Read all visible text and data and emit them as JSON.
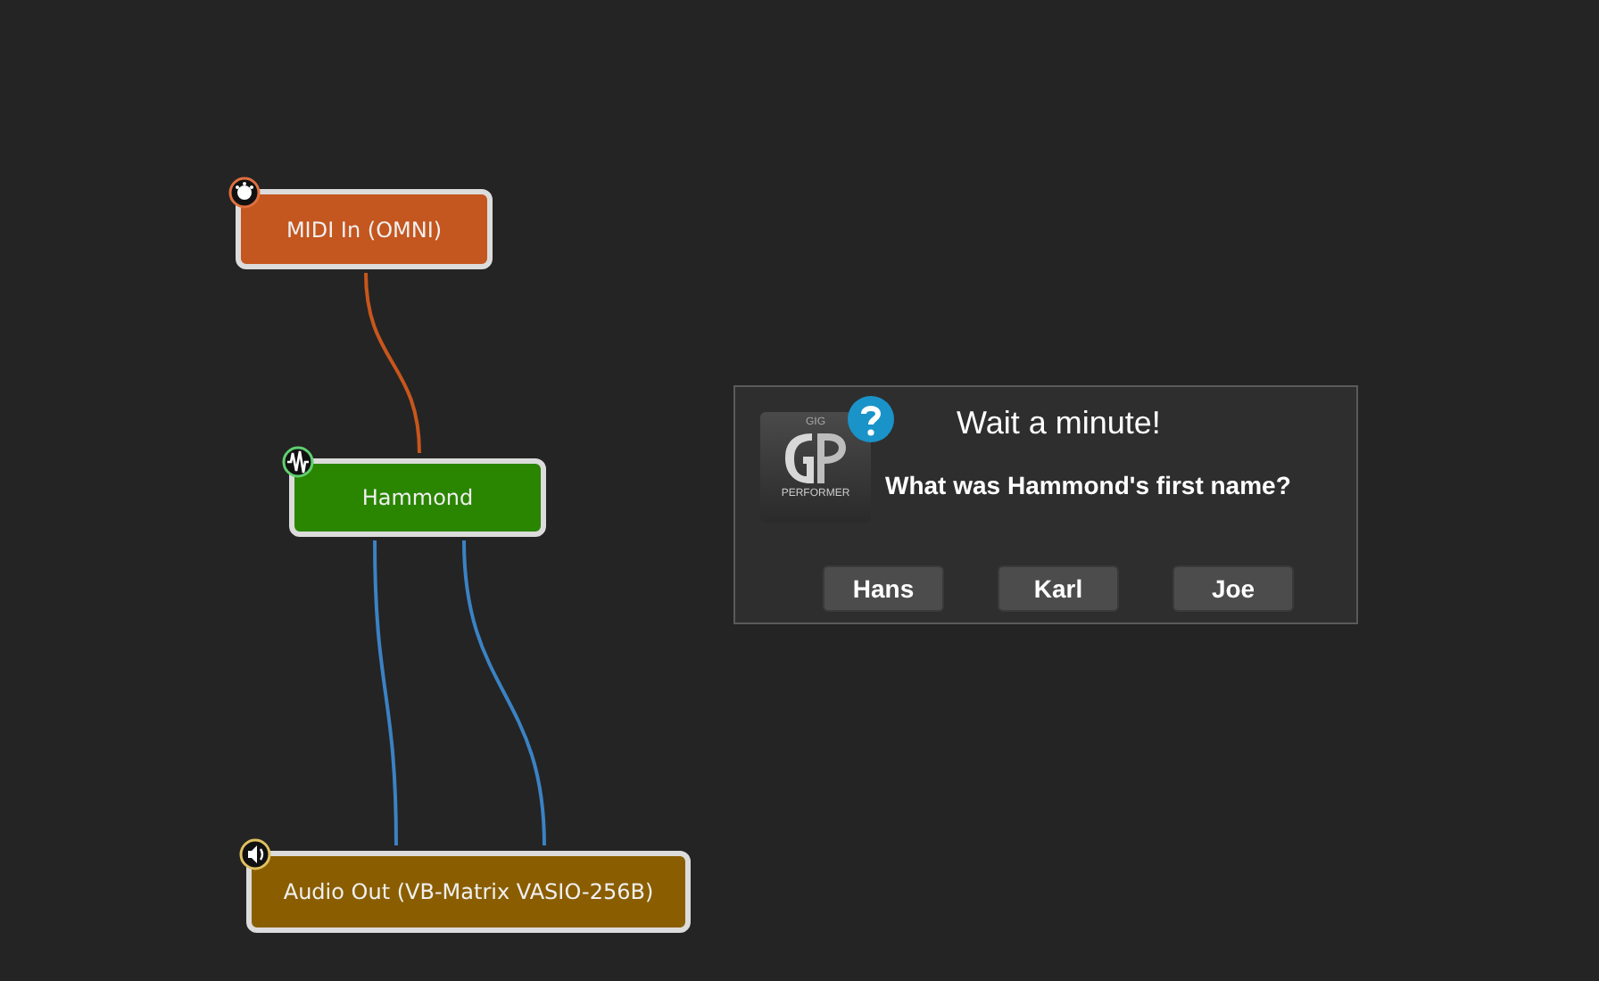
{
  "nodes": [
    {
      "kind": "midi",
      "label": "MIDI In (OMNI)",
      "color": "#c4561f"
    },
    {
      "kind": "plugin",
      "label": "Hammond",
      "color": "#2a8500"
    },
    {
      "kind": "audio",
      "label": "Audio Out (VB-Matrix VASIO-256B)",
      "color": "#8a5e00"
    }
  ],
  "connections": [
    {
      "color": "#c8561c"
    },
    {
      "color": "#3b82c4"
    },
    {
      "color": "#3b82c4"
    }
  ],
  "dialog": {
    "logo": {
      "top": "GIG",
      "bottom": "PERFORMER"
    },
    "title": "Wait a minute!",
    "message": "What was Hammond's first name?",
    "buttons": [
      "Hans",
      "Karl",
      "Joe"
    ]
  }
}
